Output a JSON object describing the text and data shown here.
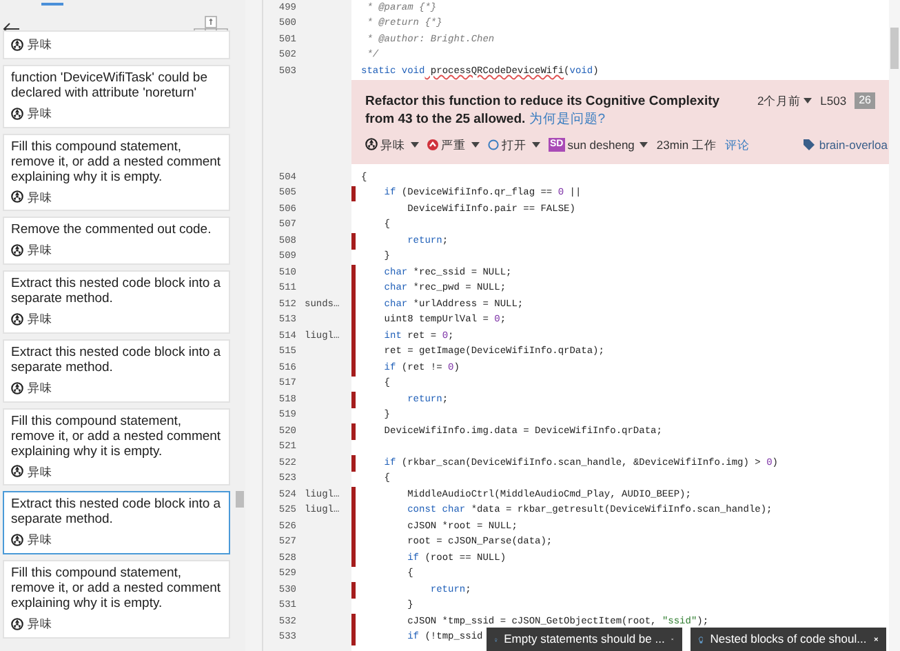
{
  "issue_list": [
    {
      "type": "异味",
      "selected": false
    },
    {
      "message": "function 'DeviceWifiTask' could be declared with attribute 'noreturn'",
      "type": "异味",
      "selected": false
    },
    {
      "message": "Fill this compound statement, remove it, or add a nested comment explaining why it is empty.",
      "type": "异味",
      "selected": false
    },
    {
      "message": "Remove the commented out code.",
      "type": "异味",
      "selected": false
    },
    {
      "message": "Extract this nested code block into a separate method.",
      "type": "异味",
      "selected": false
    },
    {
      "message": "Extract this nested code block into a separate method.",
      "type": "异味",
      "selected": false
    },
    {
      "message": "Fill this compound statement, remove it, or add a nested comment explaining why it is empty.",
      "type": "异味",
      "selected": false
    },
    {
      "message": "Extract this nested code block into a separate method.",
      "type": "异味",
      "selected": true
    },
    {
      "message": "Fill this compound statement, remove it, or add a nested comment explaining why it is empty.",
      "type": "异味",
      "selected": false
    }
  ],
  "code_before": [
    {
      "n": "499",
      "marked": false,
      "seg": [
        {
          "text": " * @param {*}",
          "kind": "comment"
        }
      ]
    },
    {
      "n": "500",
      "marked": false,
      "seg": [
        {
          "text": " * @return {*}",
          "kind": "comment"
        }
      ]
    },
    {
      "n": "501",
      "marked": false,
      "seg": [
        {
          "text": " * @author: Bright.Chen",
          "kind": "comment"
        }
      ]
    },
    {
      "n": "502",
      "marked": false,
      "seg": [
        {
          "text": " */",
          "kind": "comment"
        }
      ]
    },
    {
      "n": "503",
      "marked": false,
      "seg": [
        {
          "text": "static void",
          "kind": "keyword"
        },
        {
          "text": " processQRCodeDeviceWifi",
          "kind": "error"
        },
        {
          "text": "(",
          "kind": "plain"
        },
        {
          "text": "void",
          "kind": "keyword"
        },
        {
          "text": ")",
          "kind": "plain"
        }
      ]
    }
  ],
  "issue": {
    "message": "Refactor this function to reduce its Cognitive Complexity from 43 to the 25 allowed.",
    "why_link": "为何是问题?",
    "age": "2个月前",
    "line": "L503",
    "count": "26",
    "type": "异味",
    "severity": "严重",
    "status": "打开",
    "assignee_initials": "SD",
    "assignee": "sun desheng",
    "effort": "23min 工作",
    "comment_link": "评论",
    "tag": "brain-overloa"
  },
  "code_after": [
    {
      "n": "504",
      "marked": false,
      "seg": [
        {
          "text": "{",
          "kind": "plain"
        }
      ]
    },
    {
      "n": "505",
      "marked": true,
      "seg": [
        {
          "text": "    if",
          "kind": "keyword"
        },
        {
          "text": " (DeviceWifiInfo.qr_flag == ",
          "kind": "plain"
        },
        {
          "text": "0",
          "kind": "number"
        },
        {
          "text": " ||",
          "kind": "plain"
        }
      ]
    },
    {
      "n": "506",
      "marked": false,
      "seg": [
        {
          "text": "        DeviceWifiInfo.pair == FALSE)",
          "kind": "plain"
        }
      ]
    },
    {
      "n": "507",
      "marked": false,
      "seg": [
        {
          "text": "    {",
          "kind": "plain"
        }
      ]
    },
    {
      "n": "508",
      "marked": true,
      "seg": [
        {
          "text": "        return",
          "kind": "keyword"
        },
        {
          "text": ";",
          "kind": "plain"
        }
      ]
    },
    {
      "n": "509",
      "marked": false,
      "seg": [
        {
          "text": "    }",
          "kind": "plain"
        }
      ]
    },
    {
      "n": "510",
      "marked": true,
      "seg": [
        {
          "text": "    char",
          "kind": "keyword"
        },
        {
          "text": " *rec_ssid = NULL;",
          "kind": "plain"
        }
      ]
    },
    {
      "n": "511",
      "marked": true,
      "seg": [
        {
          "text": "    char",
          "kind": "keyword"
        },
        {
          "text": " *rec_pwd = NULL;",
          "kind": "plain"
        }
      ]
    },
    {
      "n": "512",
      "author": "sunds…",
      "marked": true,
      "seg": [
        {
          "text": "    char",
          "kind": "keyword"
        },
        {
          "text": " *urlAddress = NULL;",
          "kind": "plain"
        }
      ]
    },
    {
      "n": "513",
      "marked": true,
      "seg": [
        {
          "text": "    uint8 tempUrlVal = ",
          "kind": "plain"
        },
        {
          "text": "0",
          "kind": "number"
        },
        {
          "text": ";",
          "kind": "plain"
        }
      ]
    },
    {
      "n": "514",
      "author": "liugl…",
      "marked": true,
      "seg": [
        {
          "text": "    int",
          "kind": "keyword"
        },
        {
          "text": " ret = ",
          "kind": "plain"
        },
        {
          "text": "0",
          "kind": "number"
        },
        {
          "text": ";",
          "kind": "plain"
        }
      ]
    },
    {
      "n": "515",
      "marked": true,
      "seg": [
        {
          "text": "    ret = getImage(DeviceWifiInfo.qrData);",
          "kind": "plain"
        }
      ]
    },
    {
      "n": "516",
      "marked": true,
      "seg": [
        {
          "text": "    if",
          "kind": "keyword"
        },
        {
          "text": " (ret != ",
          "kind": "plain"
        },
        {
          "text": "0",
          "kind": "number"
        },
        {
          "text": ")",
          "kind": "plain"
        }
      ]
    },
    {
      "n": "517",
      "marked": false,
      "seg": [
        {
          "text": "    {",
          "kind": "plain"
        }
      ]
    },
    {
      "n": "518",
      "marked": true,
      "seg": [
        {
          "text": "        return",
          "kind": "keyword"
        },
        {
          "text": ";",
          "kind": "plain"
        }
      ]
    },
    {
      "n": "519",
      "marked": false,
      "seg": [
        {
          "text": "    }",
          "kind": "plain"
        }
      ]
    },
    {
      "n": "520",
      "marked": true,
      "seg": [
        {
          "text": "    DeviceWifiInfo.img.data = DeviceWifiInfo.qrData;",
          "kind": "plain"
        }
      ]
    },
    {
      "n": "521",
      "marked": false
    },
    {
      "n": "522",
      "marked": true,
      "seg": [
        {
          "text": "    if",
          "kind": "keyword"
        },
        {
          "text": " (rkbar_scan(DeviceWifiInfo.scan_handle, &DeviceWifiInfo.img) > ",
          "kind": "plain"
        },
        {
          "text": "0",
          "kind": "number"
        },
        {
          "text": ")",
          "kind": "plain"
        }
      ]
    },
    {
      "n": "523",
      "marked": false,
      "seg": [
        {
          "text": "    {",
          "kind": "plain"
        }
      ]
    },
    {
      "n": "524",
      "author": "liugl…",
      "marked": true,
      "seg": [
        {
          "text": "        MiddleAudioCtrl(MiddleAudioCmd_Play, AUDIO_BEEP);",
          "kind": "plain"
        }
      ]
    },
    {
      "n": "525",
      "author": "liugl…",
      "marked": true,
      "seg": [
        {
          "text": "        const char",
          "kind": "keyword"
        },
        {
          "text": " *data = rkbar_getresult(DeviceWifiInfo.scan_handle);",
          "kind": "plain"
        }
      ]
    },
    {
      "n": "526",
      "marked": true,
      "seg": [
        {
          "text": "        cJSON *root = NULL;",
          "kind": "plain"
        }
      ]
    },
    {
      "n": "527",
      "marked": true,
      "seg": [
        {
          "text": "        root = cJSON_Parse(data);",
          "kind": "plain"
        }
      ]
    },
    {
      "n": "528",
      "marked": true,
      "seg": [
        {
          "text": "        if",
          "kind": "keyword"
        },
        {
          "text": " (root == NULL)",
          "kind": "plain"
        }
      ]
    },
    {
      "n": "529",
      "marked": false,
      "seg": [
        {
          "text": "        {",
          "kind": "plain"
        }
      ]
    },
    {
      "n": "530",
      "marked": true,
      "seg": [
        {
          "text": "            return",
          "kind": "keyword"
        },
        {
          "text": ";",
          "kind": "plain"
        }
      ]
    },
    {
      "n": "531",
      "marked": false,
      "seg": [
        {
          "text": "        }",
          "kind": "plain"
        }
      ]
    },
    {
      "n": "532",
      "marked": true,
      "seg": [
        {
          "text": "        cJSON *tmp_ssid = cJSON_GetObjectItem(root, ",
          "kind": "plain"
        },
        {
          "text": "\"ssid\"",
          "kind": "string"
        },
        {
          "text": ");",
          "kind": "plain"
        }
      ]
    },
    {
      "n": "533",
      "marked": true,
      "seg": [
        {
          "text": "        if",
          "kind": "keyword"
        },
        {
          "text": " (!tmp_ssid",
          "kind": "plain"
        }
      ]
    }
  ],
  "toasts": [
    {
      "text": "Empty statements should be ..."
    },
    {
      "text": "Nested blocks of code shoul..."
    }
  ]
}
